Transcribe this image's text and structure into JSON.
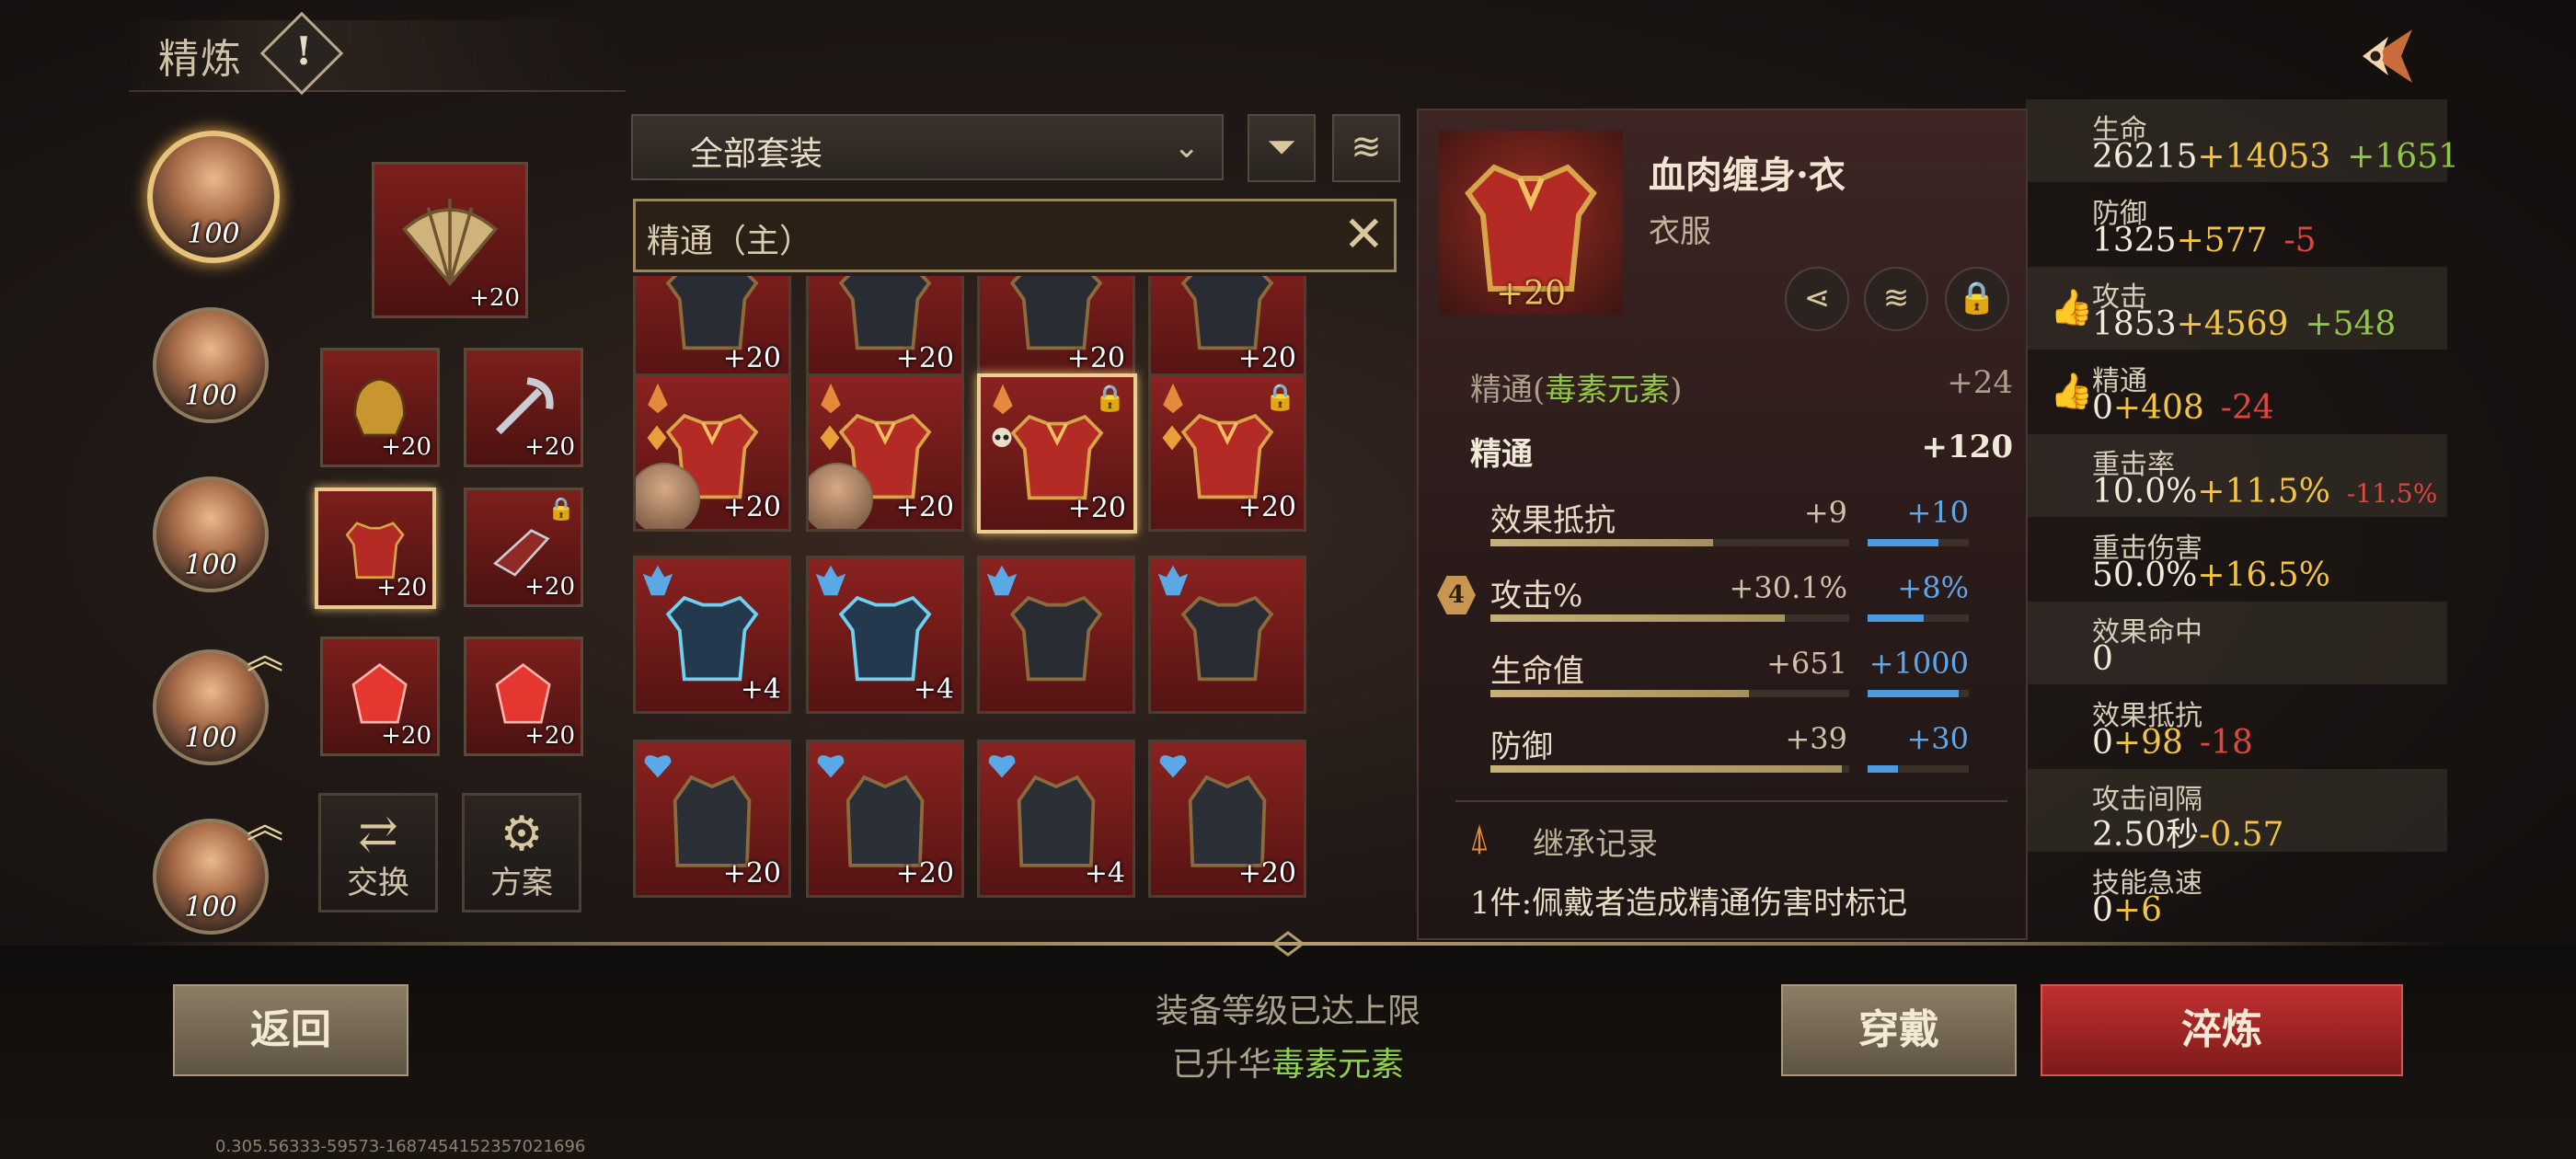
{
  "header": {
    "title": "精炼",
    "info_icon": "exclamation-icon",
    "back_icon": "back-arrow-icon"
  },
  "heroes": [
    {
      "level": "100",
      "selected": true
    },
    {
      "level": "100",
      "selected": false
    },
    {
      "level": "100",
      "selected": false
    },
    {
      "level": "100",
      "selected": false,
      "upgrade": true
    },
    {
      "level": "100",
      "selected": false,
      "upgrade": true
    }
  ],
  "equipped": {
    "accessory": {
      "level": "+20"
    },
    "slots": [
      {
        "level": "+20",
        "name": "helmet-slot"
      },
      {
        "level": "+20",
        "name": "weapon-slot"
      },
      {
        "level": "+20",
        "name": "armor-slot",
        "selected": true
      },
      {
        "level": "+20",
        "name": "gauntlet-slot",
        "locked": true
      },
      {
        "level": "+20",
        "name": "gem-slot-1"
      },
      {
        "level": "+20",
        "name": "gem-slot-2"
      }
    ],
    "buttons": {
      "swap": "交换",
      "plan": "方案"
    }
  },
  "filter": {
    "set_dropdown": "全部套装",
    "filter_icon": "funnel-icon",
    "stack_icon": "stack-icon",
    "search_tag": "精通（主）"
  },
  "grid": {
    "rows": [
      [
        "+20",
        "+20",
        "+20",
        "+20"
      ],
      [
        "+20",
        "+20",
        "+20",
        "+20"
      ],
      [
        "+4",
        "+4",
        "",
        ""
      ],
      [
        "+20",
        "+20",
        "+4",
        "+20"
      ]
    ]
  },
  "detail": {
    "item_level": "+20",
    "name": "血肉缠身·衣",
    "category": "衣服",
    "share_icon": "share-icon",
    "stack_icon": "stack-icon",
    "lock_icon": "lock-icon",
    "element_stat": {
      "label": "精通(",
      "element": "毒素元素",
      "label_end": ")",
      "value": "+24"
    },
    "main_stat": {
      "label": "精通",
      "value": "+120"
    },
    "substats": [
      {
        "name": "效果抵抗",
        "value": "+9",
        "bonus": "+10",
        "fill": 0.62,
        "bonus_fill": 0.7
      },
      {
        "name": "攻击%",
        "value": "+30.1%",
        "bonus": "+8%",
        "fill": 0.82,
        "bonus_fill": 0.55,
        "badge": "4"
      },
      {
        "name": "生命值",
        "value": "+651",
        "bonus": "+1000",
        "fill": 0.72,
        "bonus_fill": 0.9
      },
      {
        "name": "防御",
        "value": "+39",
        "bonus": "+30",
        "fill": 0.98,
        "bonus_fill": 0.3
      }
    ],
    "inherit_label": "继承记录",
    "set_text": "1件:佩戴者造成精通伤害时标记"
  },
  "stats": [
    {
      "label": "生命",
      "base": "26215",
      "add": "+14053",
      "diff": "+1651",
      "diff_color": "green"
    },
    {
      "label": "防御",
      "base": "1325",
      "add": "+577",
      "diff": "-5",
      "diff_color": "red"
    },
    {
      "label": "攻击",
      "base": "1853",
      "add": "+4569",
      "diff": "+548",
      "diff_color": "green",
      "thumb": true
    },
    {
      "label": "精通",
      "base": "0",
      "add": "+408",
      "diff": "-24",
      "diff_color": "red",
      "thumb": true
    },
    {
      "label": "重击率",
      "base": "10.0%",
      "add": "+11.5%",
      "diff": "-11.5%",
      "diff_color": "red"
    },
    {
      "label": "重击伤害",
      "base": "50.0%",
      "add": "+16.5%",
      "diff": "",
      "diff_color": ""
    },
    {
      "label": "效果命中",
      "base": "0",
      "add": "",
      "diff": "",
      "diff_color": ""
    },
    {
      "label": "效果抵抗",
      "base": "0",
      "add": "+98",
      "diff": "-18",
      "diff_color": "red"
    },
    {
      "label": "攻击间隔",
      "base": "2.50秒",
      "add": "-0.57",
      "diff": "",
      "diff_color": ""
    },
    {
      "label": "技能急速",
      "base": "0",
      "add": "+6",
      "diff": "",
      "diff_color": ""
    }
  ],
  "bottom": {
    "back_button": "返回",
    "equip_button": "穿戴",
    "refine_button": "淬炼",
    "notice_line1": "装备等级已达上限",
    "notice_line2_prefix": "已升华",
    "notice_line2_element": "毒素元素",
    "version": "0.305.56333-59573-1687454152357021696"
  },
  "colors": {
    "accent_red": "#c0302f",
    "gold": "#f3c443",
    "green": "#8fc743",
    "red": "#e0463d",
    "blue": "#5fa7e8"
  }
}
